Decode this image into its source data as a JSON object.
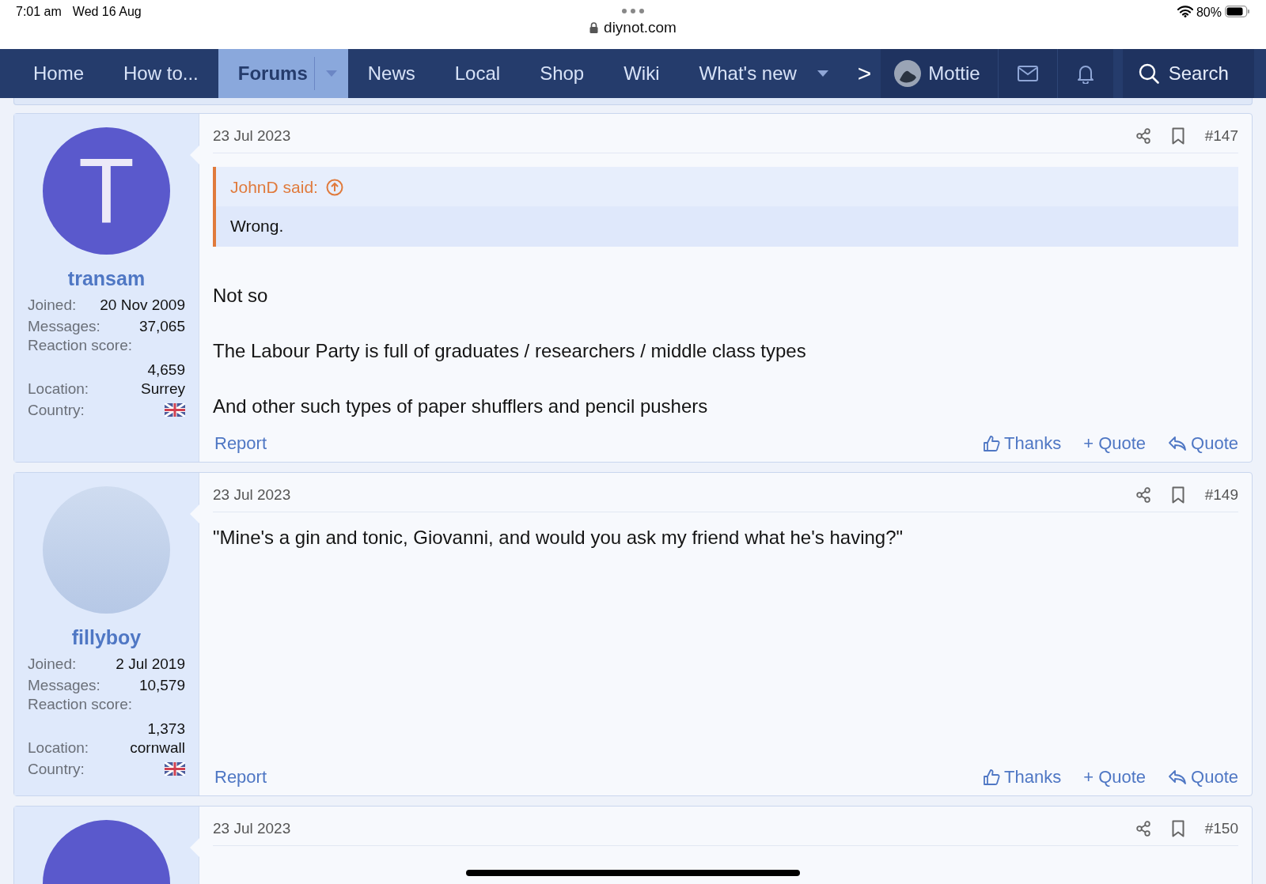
{
  "status_bar": {
    "time": "7:01 am",
    "date": "Wed 16 Aug",
    "battery": "80%",
    "url": "diynot.com"
  },
  "nav": {
    "items": [
      {
        "label": "Home",
        "selected": false,
        "dropdown": false
      },
      {
        "label": "How to...",
        "selected": false,
        "dropdown": false
      },
      {
        "label": "Forums",
        "selected": true,
        "dropdown": true
      },
      {
        "label": "News",
        "selected": false,
        "dropdown": false
      },
      {
        "label": "Local",
        "selected": false,
        "dropdown": false
      },
      {
        "label": "Shop",
        "selected": false,
        "dropdown": false
      },
      {
        "label": "Wiki",
        "selected": false,
        "dropdown": false
      },
      {
        "label": "What's new",
        "selected": false,
        "dropdown": true
      }
    ],
    "more": ">",
    "user": "Mottie",
    "search": "Search"
  },
  "posts": [
    {
      "date": "23 Jul 2023",
      "number": "#147",
      "avatar": {
        "kind": "letter",
        "letter": "T"
      },
      "username": "transam",
      "stats": [
        {
          "label": "Joined:",
          "value": "20 Nov 2009"
        },
        {
          "label": "Messages:",
          "value": "37,065"
        },
        {
          "label": "Reaction score:",
          "value": "4,659"
        },
        {
          "label": "Location:",
          "value": "Surrey"
        },
        {
          "label": "Country:",
          "kind": "flag"
        }
      ],
      "quote": {
        "author": "JohnD said:",
        "text": "Wrong."
      },
      "paragraphs": [
        "Not so",
        "The Labour Party is full of graduates / researchers / middle class types",
        "And other such types of paper shufflers and pencil pushers"
      ],
      "actions": {
        "report": "Report",
        "thanks": "Thanks",
        "multiquote": "+ Quote",
        "quote": "Quote"
      }
    },
    {
      "date": "23 Jul 2023",
      "number": "#149",
      "avatar": {
        "kind": "photo"
      },
      "username": "fillyboy",
      "stats": [
        {
          "label": "Joined:",
          "value": "2 Jul 2019"
        },
        {
          "label": "Messages:",
          "value": "10,579"
        },
        {
          "label": "Reaction score:",
          "value": "1,373"
        },
        {
          "label": "Location:",
          "value": "cornwall"
        },
        {
          "label": "Country:",
          "kind": "flag"
        }
      ],
      "paragraphs": [
        "\"Mine's a gin and tonic, Giovanni, and would you ask my friend what he's having?\""
      ],
      "actions": {
        "report": "Report",
        "thanks": "Thanks",
        "multiquote": "+ Quote",
        "quote": "Quote"
      }
    },
    {
      "date": "23 Jul 2023",
      "number": "#150",
      "avatar": {
        "kind": "letter"
      }
    }
  ]
}
